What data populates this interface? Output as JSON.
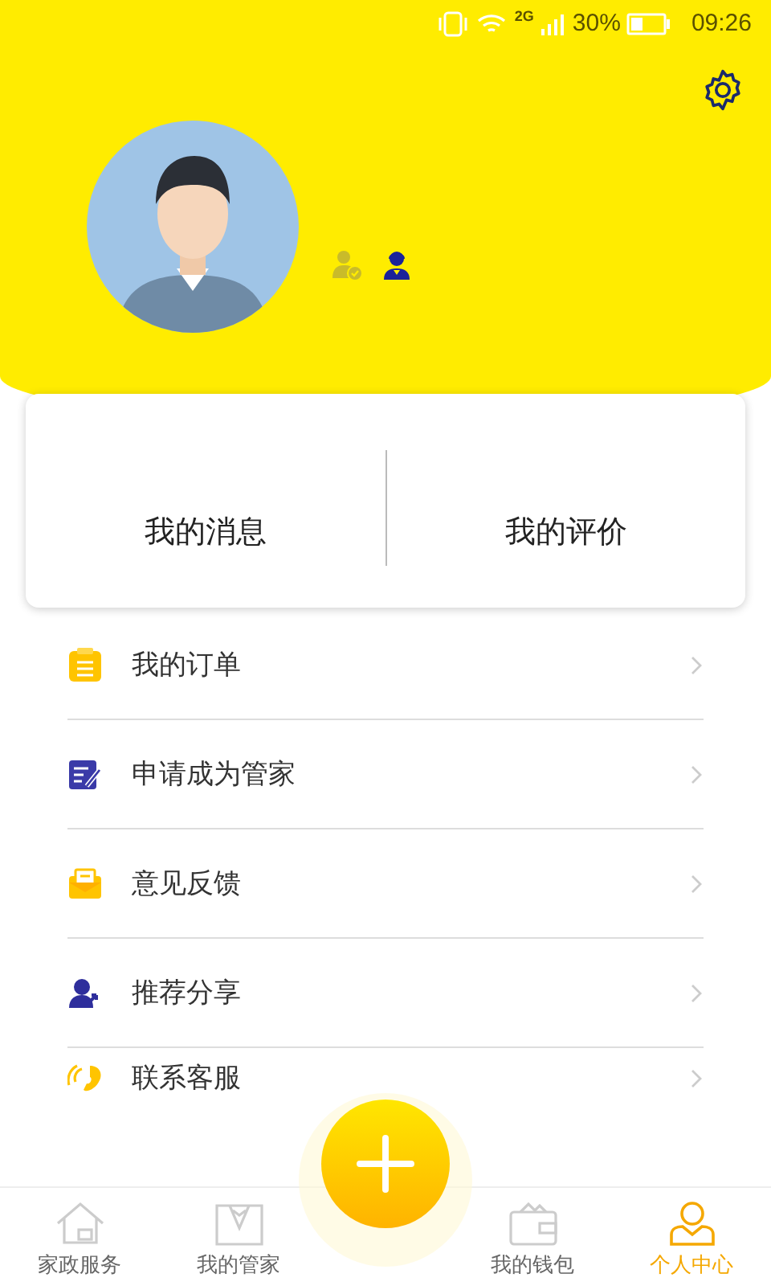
{
  "status_bar": {
    "network": "2G",
    "battery": "30%",
    "time": "09:26"
  },
  "profile": {
    "badges": [
      {
        "kind": "verified",
        "selected": false
      },
      {
        "kind": "steward",
        "selected": true
      }
    ]
  },
  "stats_card": [
    {
      "label": "我的消息"
    },
    {
      "label": "我的评价"
    }
  ],
  "menu": [
    {
      "kind": "orders",
      "label": "我的订单"
    },
    {
      "kind": "apply",
      "label": "申请成为管家"
    },
    {
      "kind": "feedback",
      "label": "意见反馈"
    },
    {
      "kind": "share",
      "label": "推荐分享"
    },
    {
      "kind": "contact",
      "label": "联系客服"
    }
  ],
  "tab_bar": [
    {
      "kind": "home",
      "label": "家政服务",
      "selected": false
    },
    {
      "kind": "steward",
      "label": "我的管家",
      "selected": false
    },
    {
      "kind": "wallet",
      "label": "我的钱包",
      "selected": false
    },
    {
      "kind": "person",
      "label": "个人中心",
      "selected": true
    }
  ]
}
